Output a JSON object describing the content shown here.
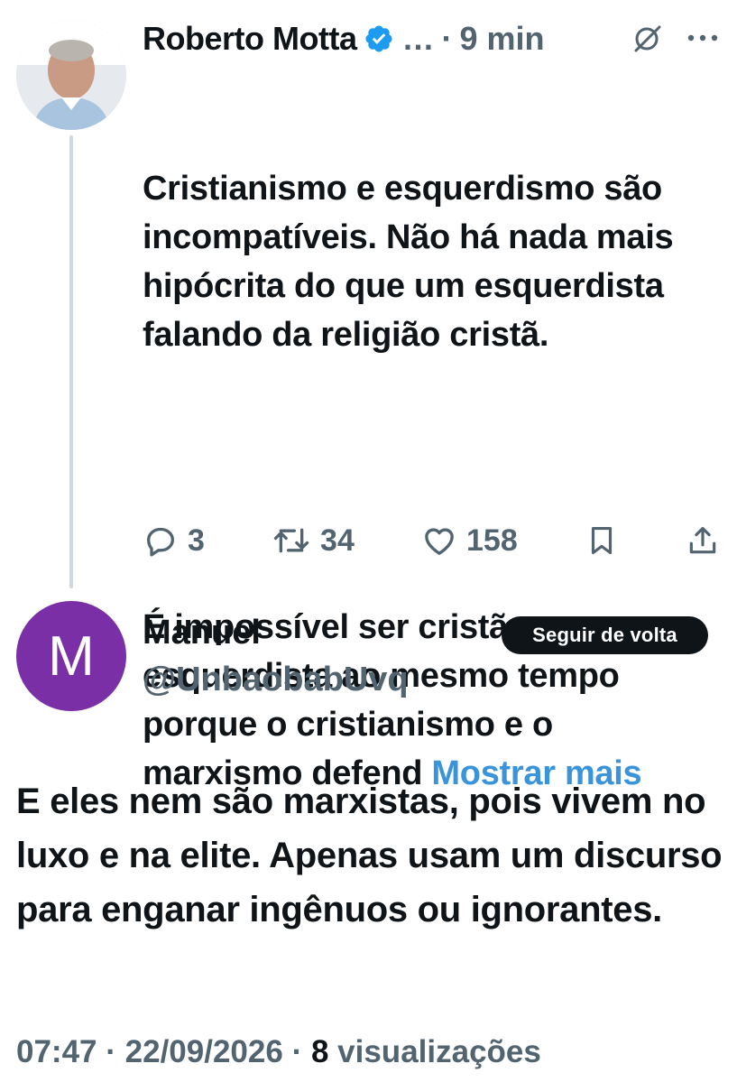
{
  "parent_tweet": {
    "author_name": "Roberto Motta",
    "ellipsis": "…",
    "separator": "·",
    "time_ago": "9 min",
    "text_para1": "Cristianismo e esquerdismo são incompatíveis. Não há nada mais hipócrita do que um esquerdista falando da religião cristã.",
    "text_para2": "É impossível ser cristão e esquerdista ao mesmo tempo porque o cristianismo e o marxismo defend",
    "show_more": "Mostrar mais",
    "replies": "3",
    "retweets": "34",
    "likes": "158"
  },
  "reply": {
    "avatar_letter": "M",
    "avatar_color": "#7b2fa6",
    "author_name": "Manuel",
    "handle": "@UnbaobabUvq",
    "follow_button": "Seguir de volta",
    "text": "E eles nem são marxistas, pois vivem no luxo e na elite. Apenas usam um discurso para enganar ingênuos ou ignorantes.",
    "time": "07:47",
    "date": "22/09/2026",
    "views_count": "8",
    "views_label": "visualizações",
    "separator": "·"
  },
  "colors": {
    "text": "#0f1419",
    "muted": "#536471",
    "link": "#3a94db",
    "verified": "#1d9bf0"
  },
  "icons": [
    "verified-badge-icon",
    "grok-icon",
    "more-icon",
    "reply-icon",
    "retweet-icon",
    "like-icon",
    "bookmark-icon",
    "share-icon"
  ]
}
